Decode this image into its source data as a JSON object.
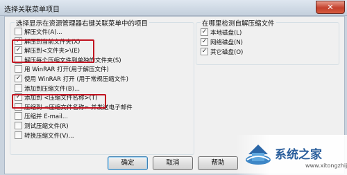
{
  "window": {
    "title": "选择关联菜单项目",
    "close_glyph": "✕"
  },
  "left_group": {
    "title": "选择显示在资源管理器右键关联菜单中的项目",
    "items": [
      {
        "label": "解压文件(A)...",
        "checked": false
      },
      {
        "label": "解压到当前文件夹(X)",
        "checked": true
      },
      {
        "label": "解压到<文件夹>\\(E)",
        "checked": true
      },
      {
        "label": "解压每个压缩文件到单独的文件夹(S)",
        "checked": false
      },
      {
        "label": "用 WinRAR 打开(用于解压文件)",
        "checked": false
      },
      {
        "label": "使用 WinRAR 打开 (用于常规压缩文件)",
        "checked": true
      },
      {
        "label": "添加到压缩文件(B)...",
        "checked": false
      },
      {
        "label": "添加到 <压缩文件名称>(T)",
        "checked": true
      },
      {
        "label": "压缩到 <压缩文件名称> 并发送电子邮件",
        "checked": false
      },
      {
        "label": "压缩并 E-mail...",
        "checked": false
      },
      {
        "label": "测试压缩文件(R)",
        "checked": false
      },
      {
        "label": "转换压缩文件(V)...",
        "checked": false
      }
    ]
  },
  "right_group": {
    "title": "在哪里检测自解压缩文件",
    "items": [
      {
        "label": "本地磁盘(L)",
        "checked": true
      },
      {
        "label": "网络磁盘(N)",
        "checked": true
      },
      {
        "label": "其它磁盘(O)",
        "checked": true
      }
    ]
  },
  "buttons": {
    "ok": "确定",
    "cancel": "取消",
    "help": "帮助"
  },
  "watermark": {
    "text": "系统之家",
    "url": "www.xitongzhijia.net"
  }
}
